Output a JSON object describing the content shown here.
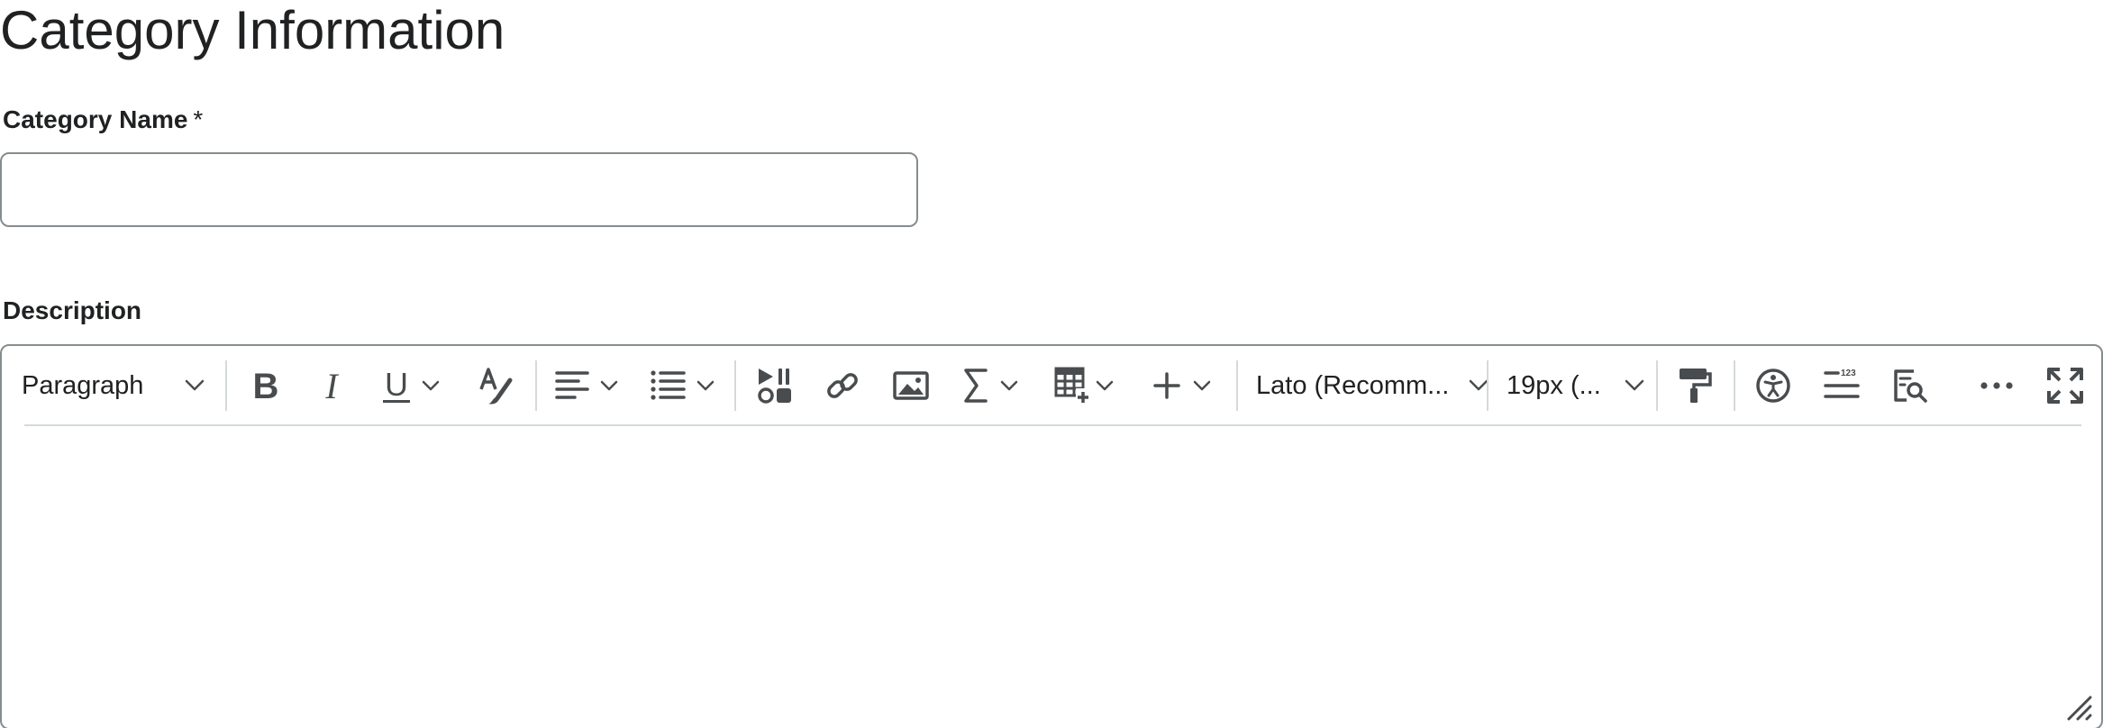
{
  "page": {
    "title": "Category Information"
  },
  "form": {
    "name_label": "Category Name",
    "name_required_marker": "*",
    "name_value": "",
    "description_label": "Description"
  },
  "toolbar": {
    "block_format": "Paragraph",
    "font_family": "Lato (Recomm...",
    "font_size": "19px (...",
    "icons": [
      "bold-icon",
      "italic-icon",
      "underline-icon",
      "text-color-icon",
      "align-icon",
      "list-icon",
      "media-icon",
      "link-icon",
      "image-icon",
      "equation-icon",
      "table-icon",
      "insert-icon",
      "format-painter-icon",
      "accessibility-icon",
      "line-numbers-icon",
      "preview-icon",
      "more-icon",
      "fullscreen-icon"
    ]
  },
  "colors": {
    "text": "#202122",
    "icon": "#494c4e",
    "border": "#868c8f",
    "divider": "#d5d9dc"
  }
}
